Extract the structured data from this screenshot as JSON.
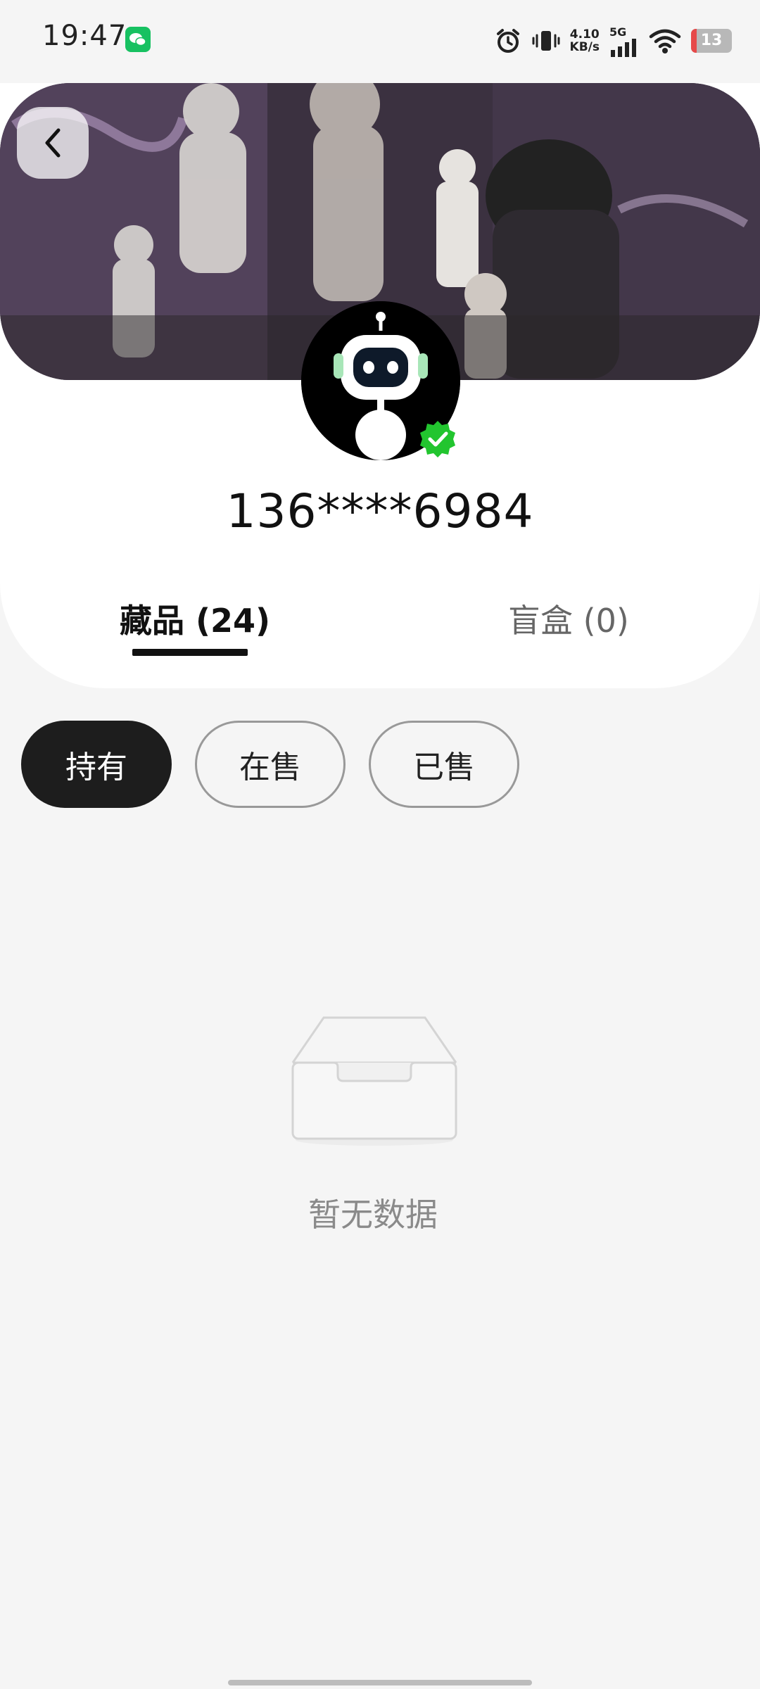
{
  "status_bar": {
    "time": "19:47",
    "net_speed_value": "4.10",
    "net_speed_unit": "KB/s",
    "network_type": "5G",
    "battery_level": "13"
  },
  "profile": {
    "username": "136****6984",
    "verified": true
  },
  "tabs": [
    {
      "label": "藏品 (24)",
      "active": true
    },
    {
      "label": "盲盒 (0)",
      "active": false
    }
  ],
  "filters": [
    {
      "label": "持有",
      "active": true
    },
    {
      "label": "在售",
      "active": false
    },
    {
      "label": "已售",
      "active": false
    }
  ],
  "empty_state": {
    "message": "暂无数据",
    "icon": "empty-inbox-icon"
  },
  "colors": {
    "page_background": "#f5f5f5",
    "active_chip": "#1d1d1d",
    "verified_green": "#22c52f",
    "battery_low": "#e64a4a"
  }
}
